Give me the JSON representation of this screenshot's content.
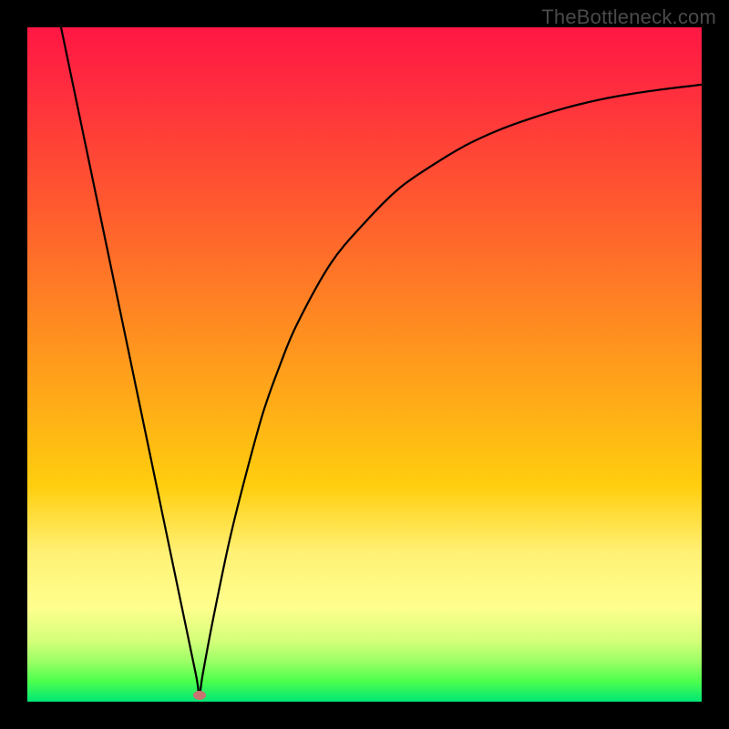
{
  "attribution": "TheBottleneck.com",
  "chart_data": {
    "type": "line",
    "title": "",
    "xlabel": "",
    "ylabel": "",
    "xlim": [
      0,
      100
    ],
    "ylim": [
      0,
      100
    ],
    "grid": false,
    "legend": false,
    "annotations": [
      {
        "shape": "oval",
        "color": "#c97373",
        "x": 25.5,
        "y": 1
      }
    ],
    "series": [
      {
        "name": "bottleneck-curve",
        "color": "#000000",
        "x": [
          5,
          7.5,
          10,
          12.5,
          15,
          17.5,
          20,
          22.5,
          25,
          25.5,
          26,
          27.5,
          30,
          32.5,
          35,
          37.5,
          40,
          45,
          50,
          55,
          60,
          65,
          70,
          75,
          80,
          85,
          90,
          95,
          100
        ],
        "values": [
          100,
          88,
          76,
          64,
          52,
          40,
          28,
          16,
          4,
          1,
          4,
          12,
          24,
          34,
          43,
          50,
          56,
          65,
          71,
          76,
          79.5,
          82.5,
          84.8,
          86.6,
          88.1,
          89.3,
          90.2,
          90.9,
          91.5
        ]
      }
    ]
  },
  "colors": {
    "frame": "#000000",
    "gradient_top": "#ff1744",
    "gradient_bottom": "#00e676",
    "curve": "#000000",
    "marker": "#c97373",
    "watermark": "#4a4a4a"
  }
}
